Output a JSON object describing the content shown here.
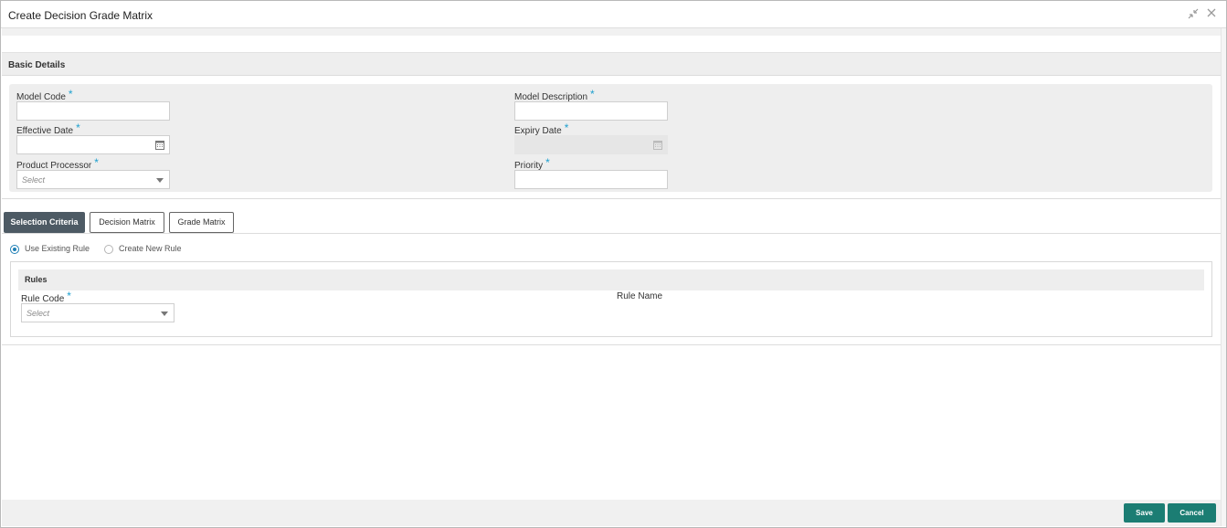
{
  "window": {
    "title": "Create Decision Grade Matrix"
  },
  "basic_details": {
    "header": "Basic Details",
    "model_code": {
      "label": "Model Code",
      "required": "*",
      "value": ""
    },
    "model_description": {
      "label": "Model Description",
      "required": "*",
      "value": ""
    },
    "effective_date": {
      "label": "Effective Date",
      "required": "*",
      "value": ""
    },
    "expiry_date": {
      "label": "Expiry Date",
      "required": "*",
      "value": ""
    },
    "product_processor": {
      "label": "Product Processor",
      "required": "*",
      "placeholder": "Select"
    },
    "priority": {
      "label": "Priority",
      "required": "*",
      "value": ""
    }
  },
  "tabs": [
    {
      "label": "Selection Criteria",
      "active": true
    },
    {
      "label": "Decision Matrix",
      "active": false
    },
    {
      "label": "Grade Matrix",
      "active": false
    }
  ],
  "rule_mode": {
    "options": [
      {
        "label": "Use Existing Rule",
        "selected": true
      },
      {
        "label": "Create New Rule",
        "selected": false
      }
    ]
  },
  "rules": {
    "header": "Rules",
    "rule_code": {
      "label": "Rule Code",
      "required": "*",
      "placeholder": "Select"
    },
    "rule_name": {
      "label": "Rule Name",
      "value": ""
    }
  },
  "footer": {
    "save_label": "Save",
    "cancel_label": "Cancel"
  },
  "colors": {
    "accent": "#1b7d73",
    "active_tab": "#4d5a64",
    "required": "#1fa0cf",
    "panel": "#eeeeee"
  }
}
